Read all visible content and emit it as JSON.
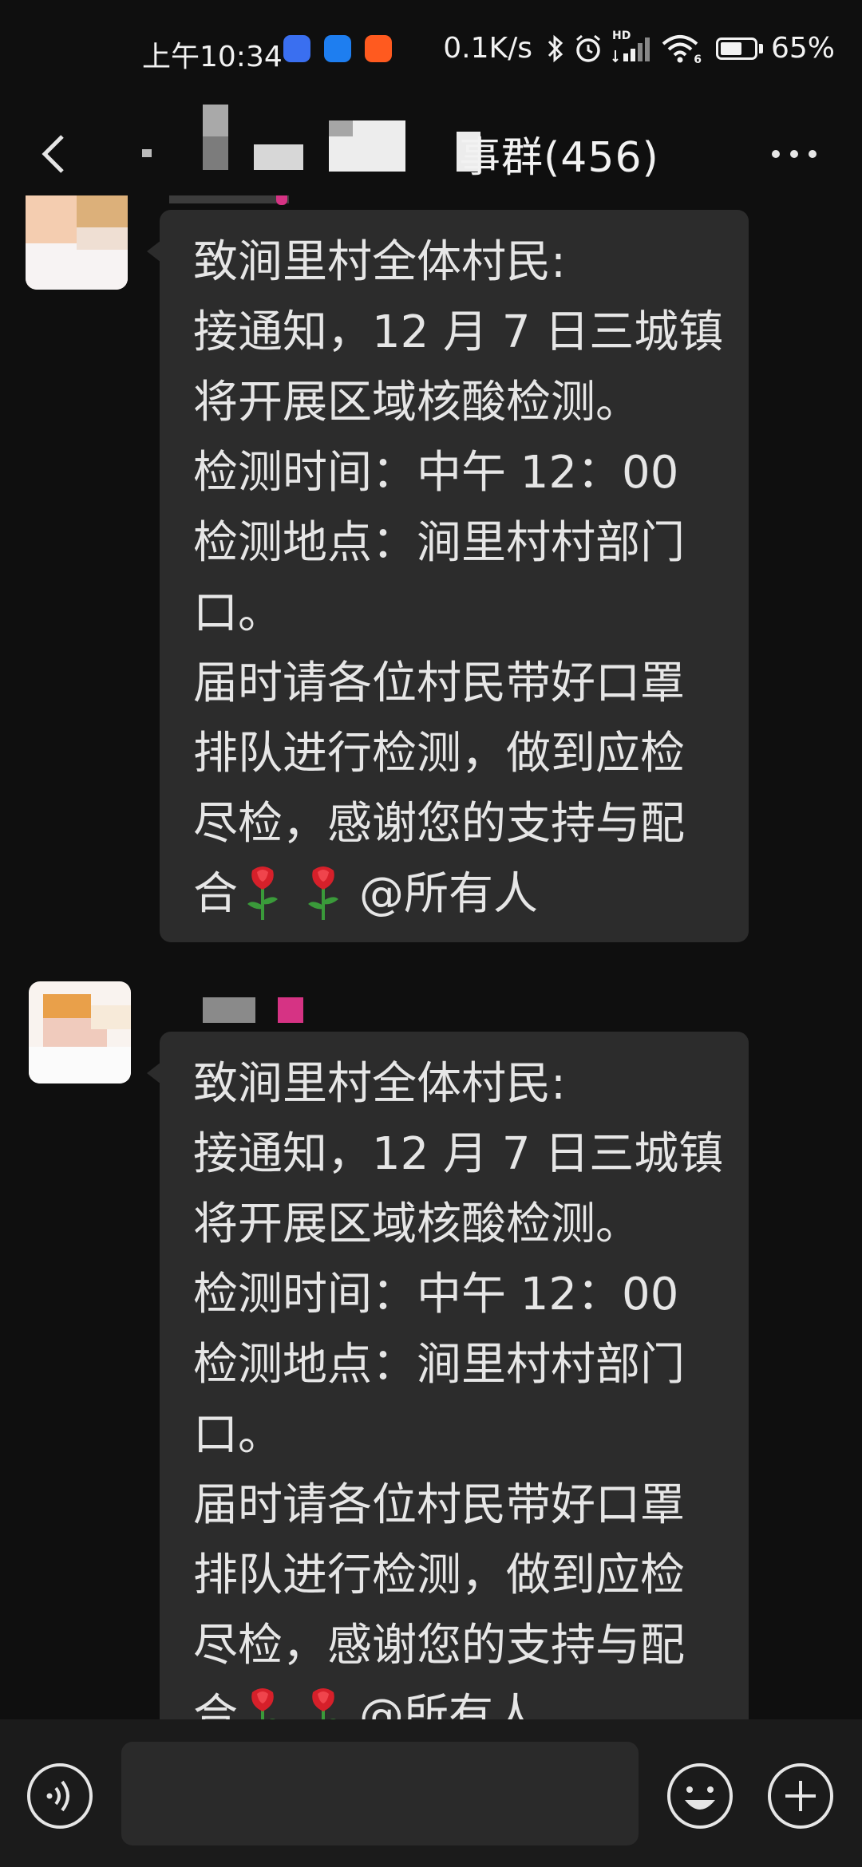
{
  "status_bar": {
    "time": "上午10:34",
    "net_speed": "0.1K/s",
    "battery": "65%",
    "battery_level": 0.65,
    "network_label": "HD",
    "wifi_label": "6"
  },
  "header": {
    "title": "事群(456)"
  },
  "messages": [
    {
      "lines": [
        "致涧里村全体村民:",
        "接通知，12 月 7 日三城镇",
        "将开展区域核酸检测。",
        "检测时间：中午 12：00",
        "检测地点：涧里村村部门",
        "口。",
        "届时请各位村民带好口罩",
        "排队进行检测，做到应检",
        "尽检，感谢您的支持与配"
      ],
      "last_line_prefix": "合",
      "last_line_suffix": "@所有人"
    },
    {
      "lines": [
        "致涧里村全体村民:",
        "接通知，12 月 7 日三城镇",
        "将开展区域核酸检测。",
        "检测时间：中午 12：00",
        "检测地点：涧里村村部门",
        "口。",
        "届时请各位村民带好口罩",
        "排队进行检测，做到应检",
        "尽检，感谢您的支持与配"
      ],
      "last_line_prefix": "合",
      "last_line_suffix": "@所有人"
    }
  ],
  "input": {
    "placeholder": ""
  },
  "colors": {
    "background": "#0f0f0f",
    "bubble": "#2c2c2c",
    "input_bar": "#1b1b1b",
    "text": "#e6e6e6",
    "accent_pink": "#d63384"
  },
  "icons": {
    "back": "chevron-left-icon",
    "more": "more-dots-icon",
    "voice": "voice-icon",
    "emoji": "emoji-icon",
    "plus": "plus-icon",
    "rose": "rose-icon"
  }
}
